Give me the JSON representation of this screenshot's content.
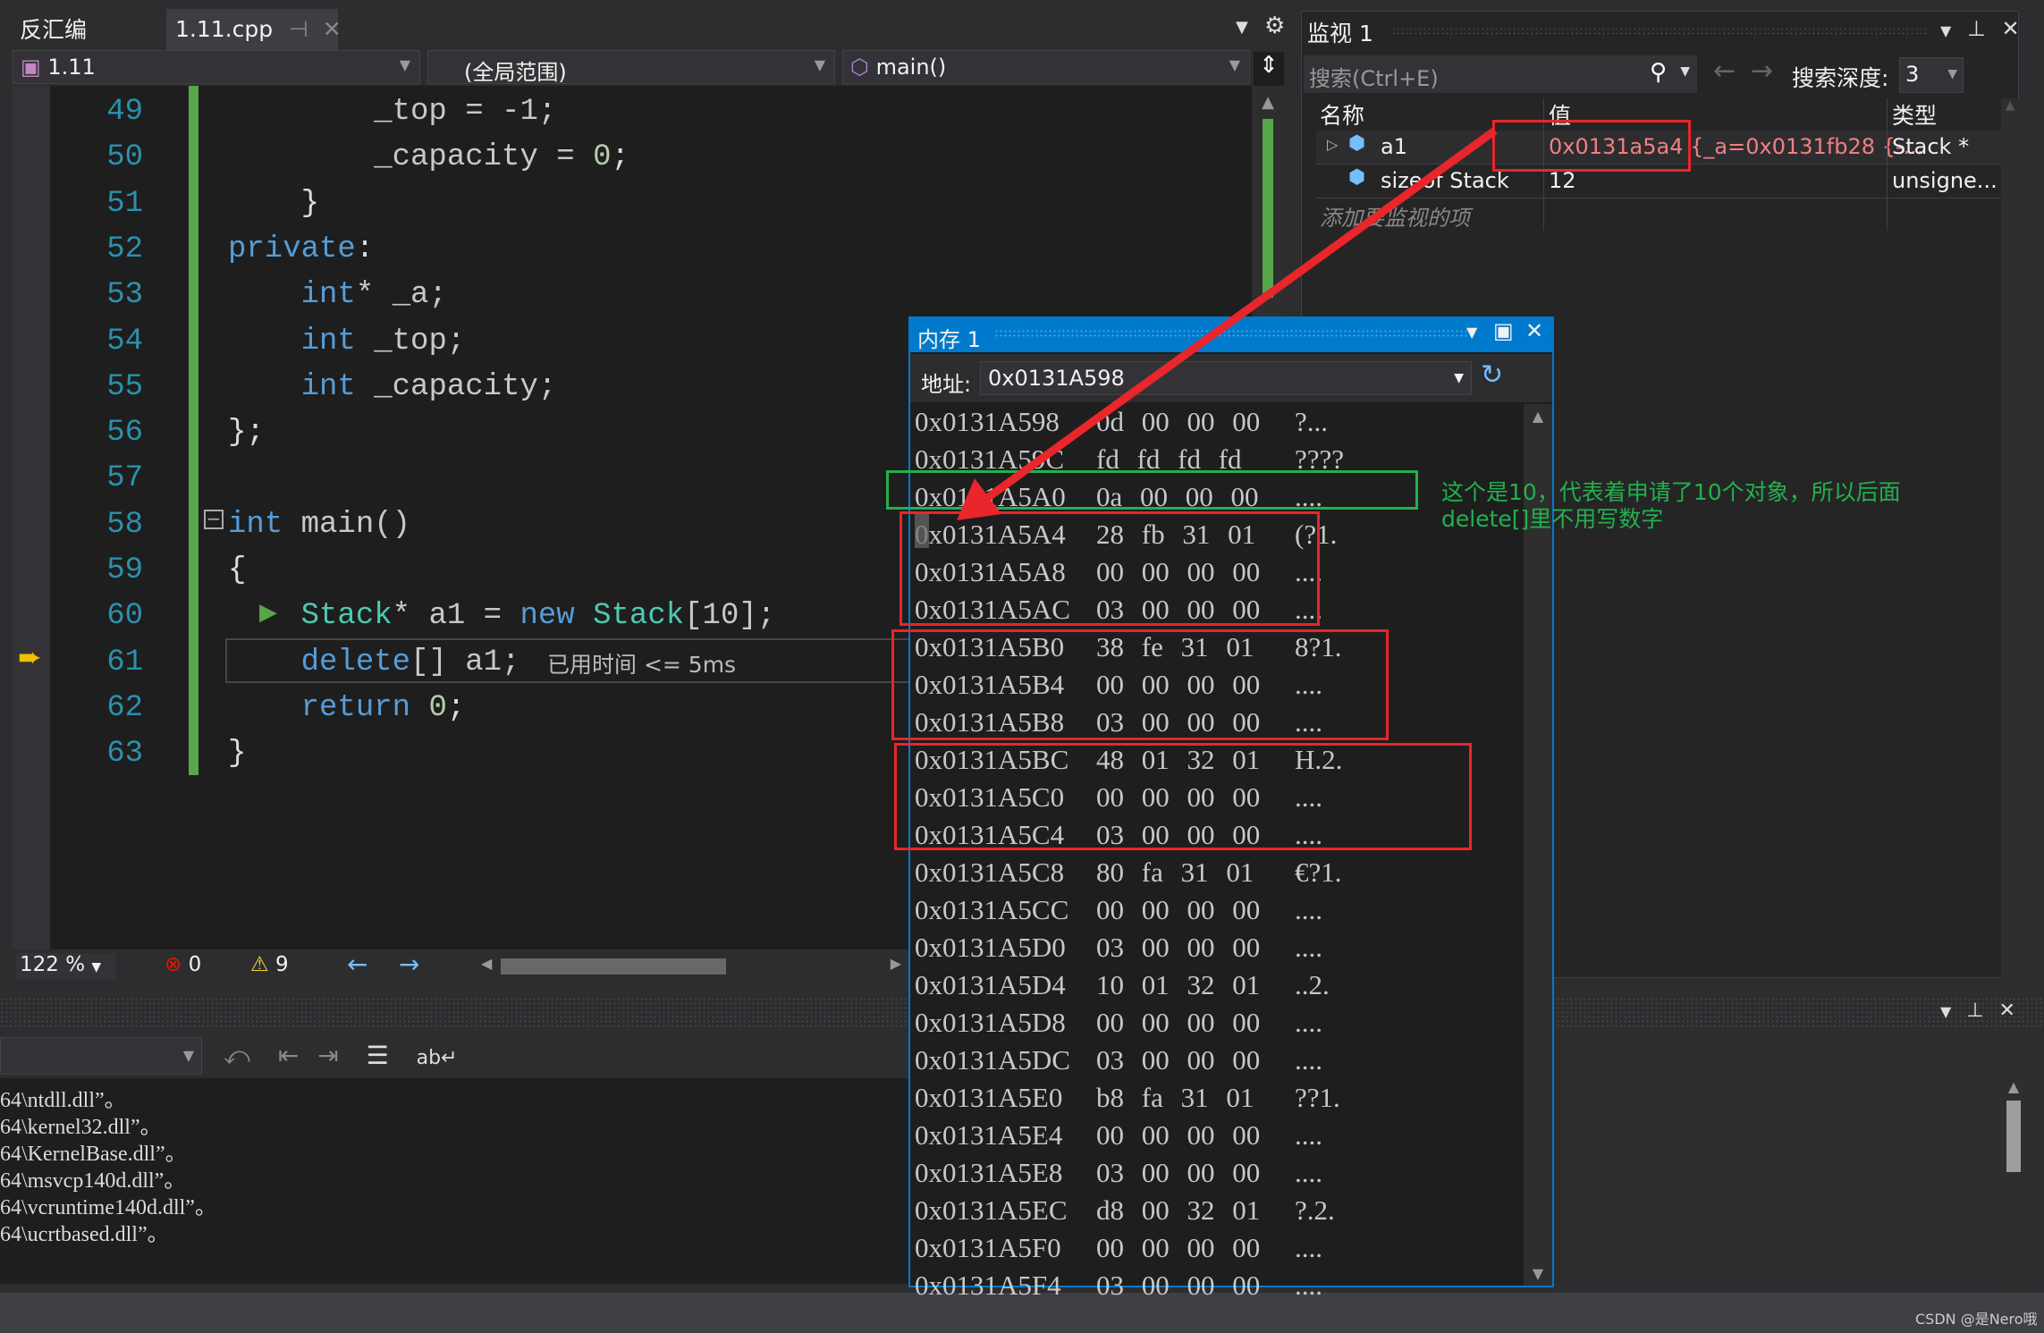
{
  "editor": {
    "tabs": [
      {
        "label": "反汇编"
      },
      {
        "label": "1.11.cpp",
        "active": true
      }
    ],
    "project_dropdown": "1.11",
    "scope_dropdown": "(全局范围)",
    "function_dropdown": "main()",
    "lines": [
      {
        "n": "49",
        "tokens": [
          [
            "        _top = -1;",
            "id"
          ]
        ]
      },
      {
        "n": "50",
        "tokens": [
          [
            "        _capacity = ",
            "id"
          ],
          [
            "0",
            "nu"
          ],
          [
            ";",
            "pl"
          ]
        ]
      },
      {
        "n": "51",
        "tokens": [
          [
            "    }",
            "pl"
          ]
        ]
      },
      {
        "n": "52",
        "tokens": [
          [
            "private",
            "pv"
          ],
          [
            ":",
            "pl"
          ]
        ]
      },
      {
        "n": "53",
        "tokens": [
          [
            "    ",
            "pl"
          ],
          [
            "int",
            "kw"
          ],
          [
            "* _a;",
            "id"
          ]
        ]
      },
      {
        "n": "54",
        "tokens": [
          [
            "    ",
            "pl"
          ],
          [
            "int",
            "kw"
          ],
          [
            " _top;",
            "id"
          ]
        ]
      },
      {
        "n": "55",
        "tokens": [
          [
            "    ",
            "pl"
          ],
          [
            "int",
            "kw"
          ],
          [
            " _capacity;",
            "id"
          ]
        ]
      },
      {
        "n": "56",
        "tokens": [
          [
            "};",
            "pl"
          ]
        ]
      },
      {
        "n": "57",
        "tokens": []
      },
      {
        "n": "58",
        "tokens": [
          [
            "int",
            "kw"
          ],
          [
            " main()",
            "id"
          ]
        ]
      },
      {
        "n": "59",
        "tokens": [
          [
            "{",
            "pl"
          ]
        ]
      },
      {
        "n": "60",
        "tokens": [
          [
            "    ",
            "pl"
          ],
          [
            "Stack",
            "ty"
          ],
          [
            "* a1 = ",
            "id"
          ],
          [
            "new",
            "kw"
          ],
          [
            " ",
            "pl"
          ],
          [
            "Stack",
            "ty"
          ],
          [
            "[10];",
            "id"
          ]
        ]
      },
      {
        "n": "61",
        "tokens": [
          [
            "    ",
            "pl"
          ],
          [
            "delete",
            "kw"
          ],
          [
            "[] a1;",
            "id"
          ]
        ]
      },
      {
        "n": "62",
        "tokens": [
          [
            "    ",
            "pl"
          ],
          [
            "return",
            "kw"
          ],
          [
            " ",
            "pl"
          ],
          [
            "0",
            "nu"
          ],
          [
            ";",
            "pl"
          ]
        ]
      },
      {
        "n": "63",
        "tokens": [
          [
            "}",
            "pl"
          ]
        ]
      }
    ],
    "elapsed_hint": "已用时间 <= 5ms",
    "status": {
      "zoom": "122 %",
      "errors": "0",
      "warnings": "9"
    }
  },
  "watch": {
    "title": "监视 1",
    "search_placeholder": "搜索(Ctrl+E)",
    "depth_label": "搜索深度:",
    "depth_value": "3",
    "columns": [
      "名称",
      "值",
      "类型"
    ],
    "rows": [
      {
        "name": "a1",
        "value": "0x0131a5a4 {_a=0x0131fb28 {-...",
        "type": "Stack *",
        "value_color": "#f08080"
      },
      {
        "name": "sizeof Stack",
        "value": "12",
        "type": "unsigne..."
      }
    ],
    "add_item": "添加要监视的项"
  },
  "memory": {
    "title": "内存 1",
    "address_label": "地址:",
    "address_value": "0x0131A598",
    "rows": [
      [
        "0x0131A598",
        "0d 00 00 00",
        "?..."
      ],
      [
        "0x0131A59C",
        "fd fd fd fd",
        "????"
      ],
      [
        "0x0131A5A0",
        "0a 00 00 00",
        "...."
      ],
      [
        "0x0131A5A4",
        "28 fb 31 01",
        "(?1."
      ],
      [
        "0x0131A5A8",
        "00 00 00 00",
        "...."
      ],
      [
        "0x0131A5AC",
        "03 00 00 00",
        "...."
      ],
      [
        "0x0131A5B0",
        "38 fe 31 01",
        "8?1."
      ],
      [
        "0x0131A5B4",
        "00 00 00 00",
        "...."
      ],
      [
        "0x0131A5B8",
        "03 00 00 00",
        "...."
      ],
      [
        "0x0131A5BC",
        "48 01 32 01",
        "H.2."
      ],
      [
        "0x0131A5C0",
        "00 00 00 00",
        "...."
      ],
      [
        "0x0131A5C4",
        "03 00 00 00",
        "...."
      ],
      [
        "0x0131A5C8",
        "80 fa 31 01",
        "€?1."
      ],
      [
        "0x0131A5CC",
        "00 00 00 00",
        "...."
      ],
      [
        "0x0131A5D0",
        "03 00 00 00",
        "...."
      ],
      [
        "0x0131A5D4",
        "10 01 32 01",
        "..2."
      ],
      [
        "0x0131A5D8",
        "00 00 00 00",
        "...."
      ],
      [
        "0x0131A5DC",
        "03 00 00 00",
        "...."
      ],
      [
        "0x0131A5E0",
        "b8 fa 31 01",
        "??1."
      ],
      [
        "0x0131A5E4",
        "00 00 00 00",
        "...."
      ],
      [
        "0x0131A5E8",
        "03 00 00 00",
        "...."
      ],
      [
        "0x0131A5EC",
        "d8 00 32 01",
        "?.2."
      ],
      [
        "0x0131A5F0",
        "00 00 00 00",
        "...."
      ],
      [
        "0x0131A5F4",
        "03 00 00 00",
        "...."
      ]
    ]
  },
  "annotation": {
    "line1": "这个是10，代表着申请了10个对象，所以后面",
    "line2": "delete[]里不用写数字",
    "color": "#22b14c",
    "box_color": "#e8262b"
  },
  "output": {
    "lines": [
      "64\\ntdll.dll”。",
      "64\\kernel32.dll”。",
      "64\\KernelBase.dll”。",
      "64\\msvcp140d.dll”。",
      "64\\vcruntime140d.dll”。",
      "64\\ucrtbased.dll”。"
    ]
  },
  "watermark": "CSDN @是Nero哦"
}
